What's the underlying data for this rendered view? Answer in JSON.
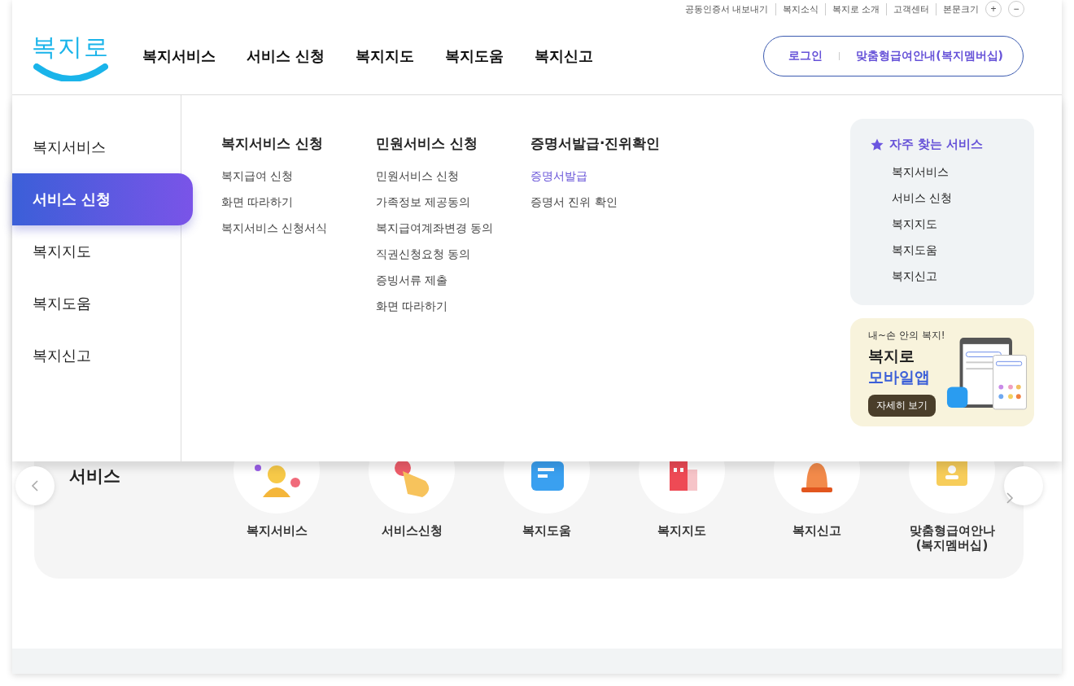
{
  "utility_links": [
    "공동인증서 내보내기",
    "복지소식",
    "복지로 소개",
    "고객센터"
  ],
  "font_size": {
    "label": "본문크기",
    "increase": "+",
    "decrease": "−"
  },
  "logo": "복지로",
  "main_nav": [
    {
      "label": "복지서비스"
    },
    {
      "label": "서비스 신청"
    },
    {
      "label": "복지지도"
    },
    {
      "label": "복지도움"
    },
    {
      "label": "복지신고"
    }
  ],
  "account_buttons": [
    "로그인",
    "맞춤형급여안내(복지멤버십)"
  ],
  "mega_menu": {
    "side_items": [
      {
        "label": "복지서비스",
        "selected": false
      },
      {
        "label": "서비스 신청",
        "selected": true
      },
      {
        "label": "복지지도",
        "selected": false
      },
      {
        "label": "복지도움",
        "selected": false
      },
      {
        "label": "복지신고",
        "selected": false
      }
    ],
    "groups": [
      {
        "title": "복지서비스 신청",
        "links": [
          {
            "label": "복지급여 신청",
            "selected": false
          },
          {
            "label": "화면 따라하기",
            "selected": false
          },
          {
            "label": "복지서비스 신청서식",
            "selected": false
          }
        ]
      },
      {
        "title": "민원서비스 신청",
        "links": [
          {
            "label": "민원서비스 신청",
            "selected": false
          },
          {
            "label": "가족정보 제공동의",
            "selected": false
          },
          {
            "label": "복지급여계좌변경 동의",
            "selected": false
          },
          {
            "label": "직권신청요청 동의",
            "selected": false
          },
          {
            "label": "증빙서류 제출",
            "selected": false
          },
          {
            "label": "화면 따라하기",
            "selected": false
          }
        ]
      },
      {
        "title": "증명서발급·진위확인",
        "links": [
          {
            "label": "증명서발급",
            "selected": true
          },
          {
            "label": "증명서 진위 확인",
            "selected": false
          }
        ]
      }
    ],
    "frequent": {
      "title": "자주 찾는 서비스",
      "items": [
        "복지서비스",
        "서비스 신청",
        "복지지도",
        "복지도움",
        "복지신고"
      ]
    },
    "app_banner": {
      "tagline": "내~손 안의 복지!",
      "title_line1": "복지로",
      "title_line2": "모바일앱",
      "button": "자세히 보기"
    }
  },
  "services_section": {
    "title": "서비스",
    "items": [
      {
        "label": "복지서비스",
        "kind": "person"
      },
      {
        "label": "서비스신청",
        "kind": "hand"
      },
      {
        "label": "복지도움",
        "kind": "note"
      },
      {
        "label": "복지지도",
        "kind": "building"
      },
      {
        "label": "복지신고",
        "kind": "siren"
      },
      {
        "label": "맞춤형급여안나\n(복지멤버십)",
        "kind": "card"
      }
    ]
  }
}
